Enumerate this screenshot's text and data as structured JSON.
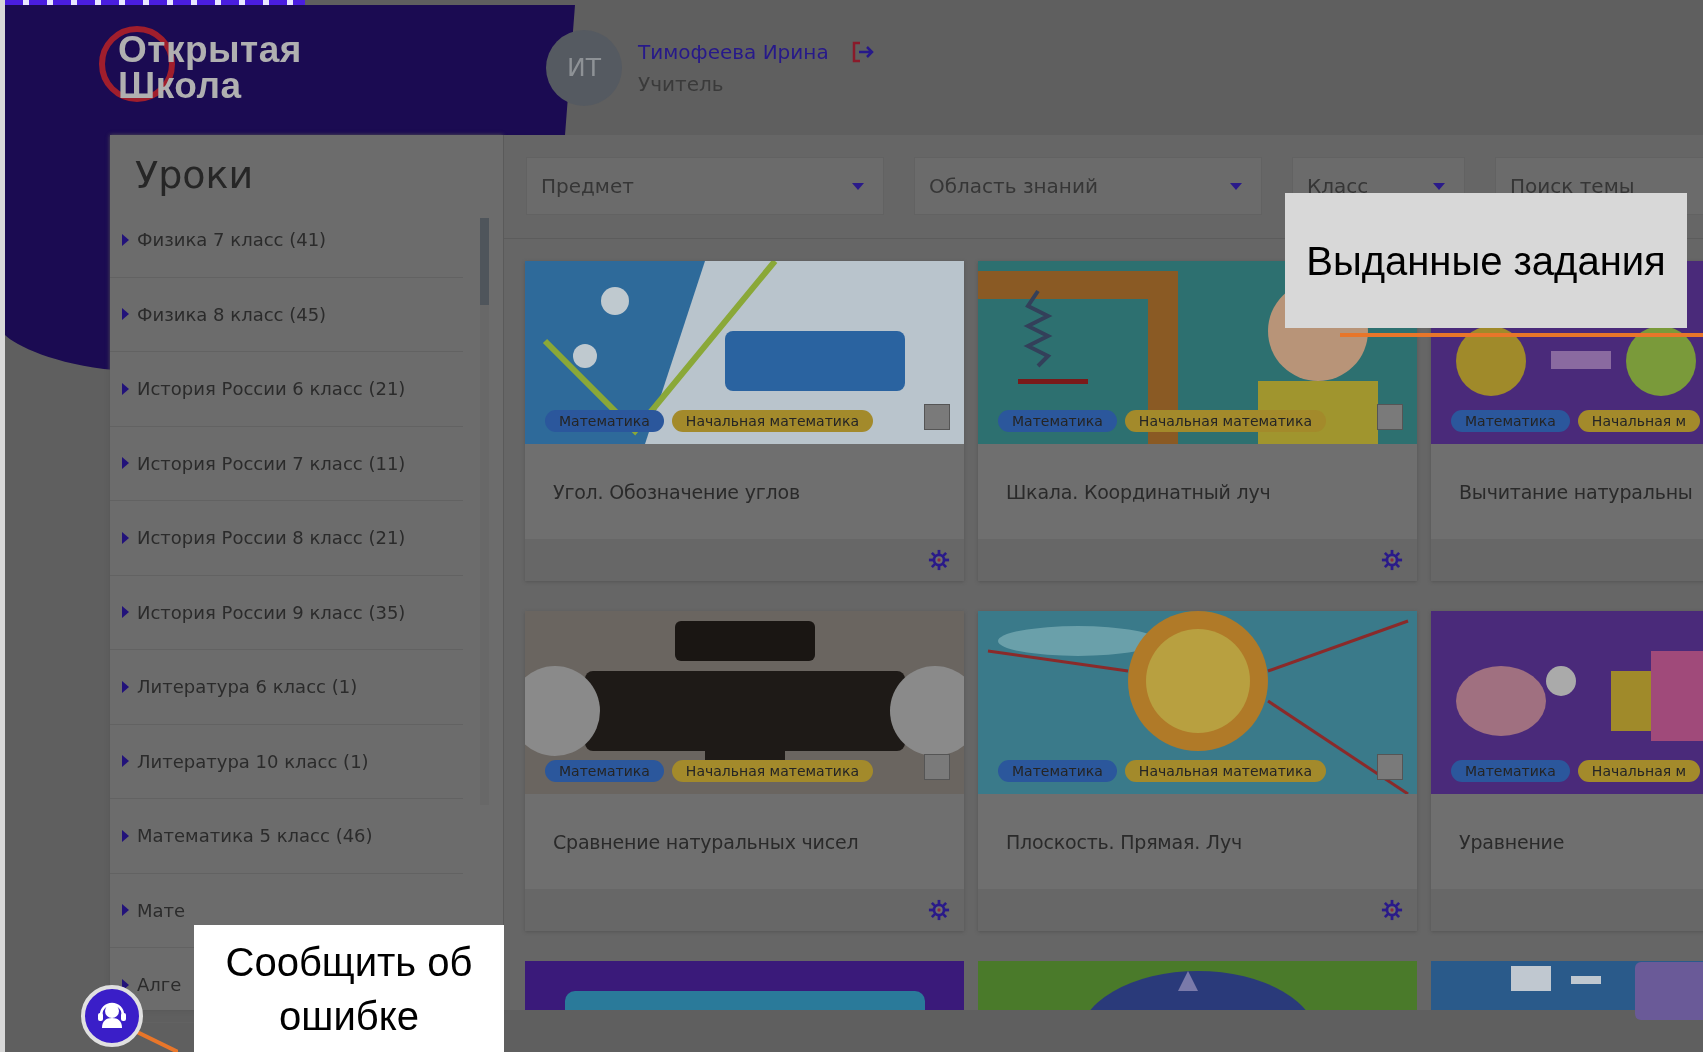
{
  "header": {
    "logo": [
      "Открытая",
      "Школа"
    ],
    "user": {
      "initials": "ИТ",
      "name": "Тимофеева Ирина",
      "role": "Учитель"
    }
  },
  "sidebar": {
    "title": "Уроки",
    "items": [
      {
        "label": "Физика 7 класс (41)"
      },
      {
        "label": "Физика 8 класс (45)"
      },
      {
        "label": "История России 6 класс (21)"
      },
      {
        "label": "История России 7 класс (11)"
      },
      {
        "label": "История России 8 класс (21)"
      },
      {
        "label": "История России 9 класс (35)"
      },
      {
        "label": "Литература 6 класс (1)"
      },
      {
        "label": "Литература 10 класс (1)"
      },
      {
        "label": "Математика 5 класс (46)"
      },
      {
        "label": "Мате"
      },
      {
        "label": "Алге"
      }
    ]
  },
  "filters": [
    {
      "kind": "select",
      "placeholder": "Предмет"
    },
    {
      "kind": "select",
      "placeholder": "Область знаний"
    },
    {
      "kind": "select",
      "placeholder": "Класс"
    },
    {
      "kind": "search",
      "placeholder": "Поиск темы"
    }
  ],
  "cards": [
    {
      "title": "Угол. Обозначение углов",
      "checked": false,
      "tags": [
        {
          "label": "Математика",
          "color": "#2b579c"
        },
        {
          "label": "Начальная математика",
          "color": "#a38a2b"
        }
      ]
    },
    {
      "title": "Шкала. Координатный луч",
      "checked": false,
      "tags": [
        {
          "label": "Математика",
          "color": "#2b579c"
        },
        {
          "label": "Начальная математика",
          "color": "#a38a2b"
        }
      ]
    },
    {
      "title": "Вычитание натуральны",
      "tags": [
        {
          "label": "Математика",
          "color": "#2b579c"
        },
        {
          "label": "Начальная м",
          "color": "#a38a2b"
        }
      ]
    },
    {
      "title": "Сравнение натуральных чисел",
      "checked": false,
      "tags": [
        {
          "label": "Математика",
          "color": "#2b579c"
        },
        {
          "label": "Начальная математика",
          "color": "#a38a2b"
        }
      ]
    },
    {
      "title": "Плоскость. Прямая. Луч",
      "checked": false,
      "tags": [
        {
          "label": "Математика",
          "color": "#2b579c"
        },
        {
          "label": "Начальная математика",
          "color": "#a38a2b"
        }
      ]
    },
    {
      "title": "Уравнение",
      "tags": [
        {
          "label": "Математика",
          "color": "#2b579c"
        },
        {
          "label": "Начальная м",
          "color": "#a38a2b"
        }
      ]
    },
    {
      "kind": "picture"
    },
    {
      "kind": "picture"
    },
    {
      "kind": "picture"
    }
  ],
  "callouts": [
    {
      "text": "Выданные задания"
    },
    {
      "text": "Сообщить об ошибке"
    }
  ]
}
